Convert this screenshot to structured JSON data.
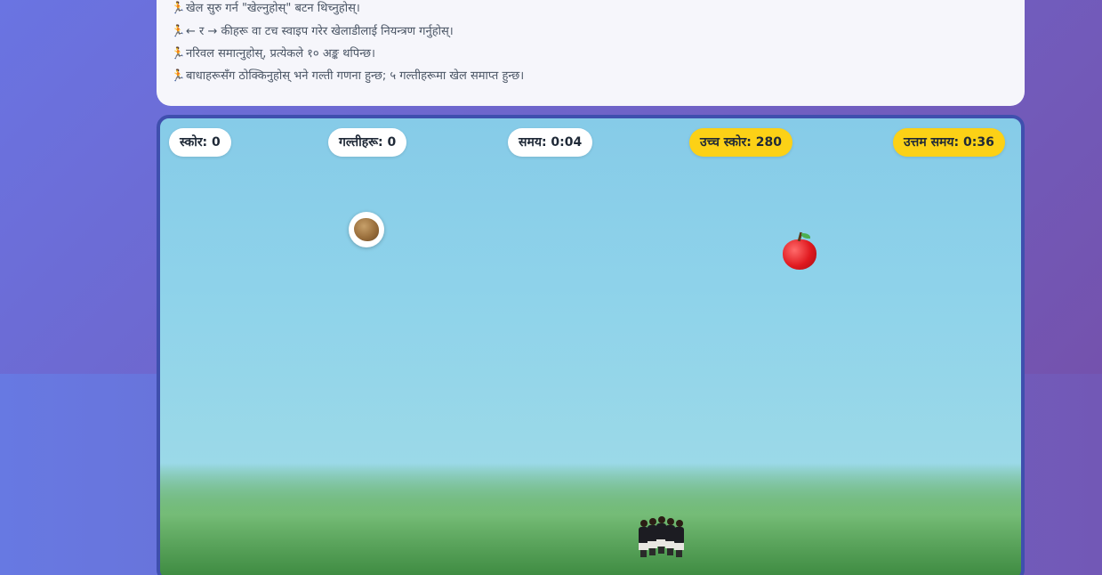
{
  "instructions": {
    "items": [
      {
        "icon": "runner-icon",
        "glyph": "🏃",
        "text": "खेल सुरु गर्न \"खेल्नुहोस्\" बटन थिच्नुहोस्।"
      },
      {
        "icon": "runner-icon",
        "glyph": "🏃",
        "text": "← र → कीहरू वा टच स्वाइप गरेर खेलाडीलाई नियन्त्रण गर्नुहोस्।"
      },
      {
        "icon": "runner-icon",
        "glyph": "🏃",
        "text": "नरिवल समात्नुहोस्, प्रत्येकले १० अङ्क थपिन्छ।"
      },
      {
        "icon": "runner-icon",
        "glyph": "🏃",
        "text": "बाधाहरूसँग ठोक्किनुहोस् भने गल्ती गणना हुन्छ; ५ गल्तीहरूमा खेल समाप्त हुन्छ।"
      }
    ]
  },
  "hud": {
    "score": "स्कोर: 0",
    "mistakes": "गल्तीहरू: 0",
    "time": "समय: 0:04",
    "high_score": "उच्च स्कोर: 280",
    "best_time": "उत्तम समय: 0:36"
  },
  "objects": {
    "falling_item_1": "coconut-icon",
    "falling_item_2": "apple-icon",
    "player": "player-dancers-icon"
  },
  "colors": {
    "background_gradient_start": "#6a74e2",
    "background_gradient_end": "#7452ad",
    "panel_background": "#f6f6fb",
    "game_border": "#3f4fae",
    "sky": "#86cbe8",
    "grass": "#3d8a40",
    "gold_badge": "#fcd116",
    "white_badge": "#ffffff"
  }
}
